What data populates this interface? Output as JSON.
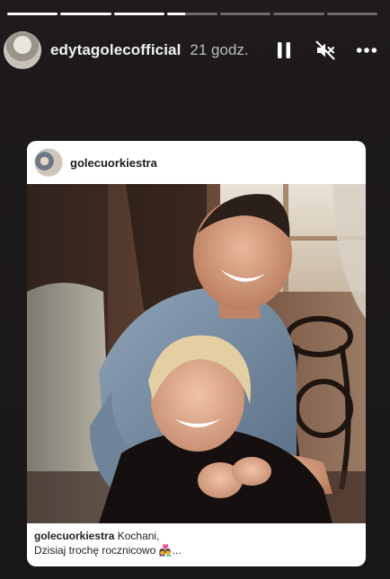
{
  "story": {
    "progress": [
      1,
      1,
      1,
      0.35,
      0,
      0,
      0
    ]
  },
  "header": {
    "username": "edytagolecofficial",
    "time": "21 godz.",
    "icons": [
      "pause-icon",
      "mute-icon",
      "more-icon"
    ]
  },
  "post": {
    "username": "golecuorkiestra",
    "caption_user": "golecuorkiestra",
    "caption_line1": "Kochani,",
    "caption_line2": "Dzisiaj trochę rocznicowo 👩‍❤️‍👨..."
  },
  "colors": {
    "background": "#1b1819",
    "card": "#ffffff"
  }
}
